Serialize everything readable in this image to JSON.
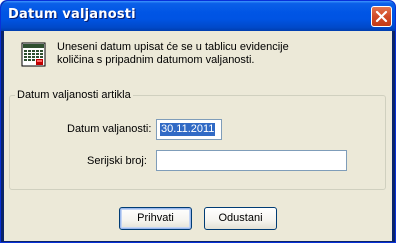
{
  "window": {
    "title": "Datum valjanosti"
  },
  "info": {
    "icon": "calendar-table-icon",
    "line1": "Uneseni datum upisat će se u tablicu evidencije",
    "line2": "količina s pripadnim datumom valjanosti."
  },
  "group": {
    "legend": "Datum valjanosti artikla",
    "date_label": "Datum valjanosti:",
    "date_value": "30.11.2011",
    "serial_label": "Serijski broj:",
    "serial_value": ""
  },
  "buttons": {
    "ok_label": "Prihvati",
    "cancel_label": "Odustani"
  },
  "colors": {
    "titlebar": "#0054e3",
    "close_button": "#d14b27",
    "dialog_bg": "#ece9d8",
    "selection": "#316ac5"
  }
}
